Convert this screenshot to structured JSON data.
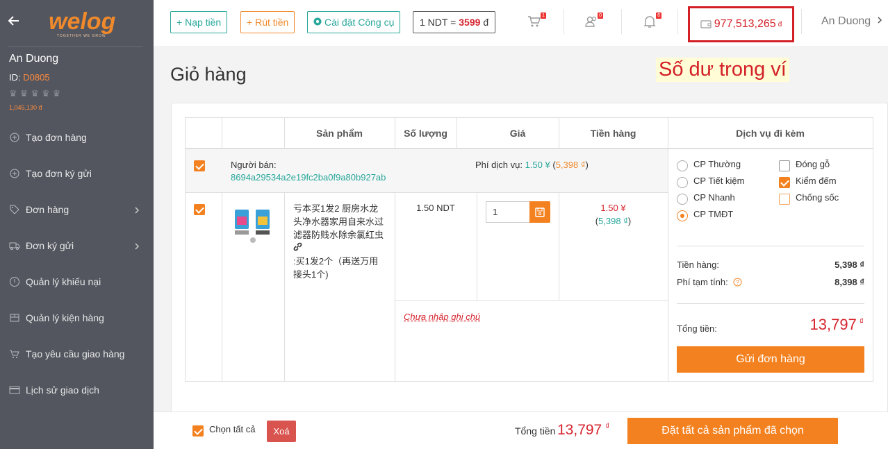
{
  "sidebar": {
    "user_name": "An Duong",
    "id_label": "ID:",
    "id_value": "D0805",
    "balance": "1,045,130 đ",
    "rating_stars": 5,
    "items": [
      {
        "label": "Tạo đơn hàng",
        "icon": "plus-circle-icon"
      },
      {
        "label": "Tạo đơn ký gửi",
        "icon": "plus-circle-icon"
      },
      {
        "label": "Đơn hàng",
        "icon": "tag-icon",
        "has_submenu": true
      },
      {
        "label": "Đơn ký gửi",
        "icon": "truck-icon",
        "has_submenu": true
      },
      {
        "label": "Quản lý khiếu nại",
        "icon": "alert-circle-icon"
      },
      {
        "label": "Quản lý kiện hàng",
        "icon": "package-icon"
      },
      {
        "label": "Tạo yêu cầu giao hàng",
        "icon": "cart-icon"
      },
      {
        "label": "Lịch sử giao dịch",
        "icon": "credit-card-icon"
      }
    ]
  },
  "header": {
    "nap_tien": "Nạp tiền",
    "rut_tien": "Rút tiền",
    "cai_dat": "Cài đặt Công cụ",
    "rate_prefix": "1 NDT =",
    "rate_value": "3599",
    "rate_suffix": "đ",
    "cart_badge": "1",
    "users_badge": "0",
    "bell_badge": "6",
    "wallet_balance": "977,513,265",
    "wallet_currency": "đ",
    "user_name": "An Duong"
  },
  "page": {
    "title": "Giỏ hàng",
    "annotation": "Số dư trong ví"
  },
  "table": {
    "headers": [
      "Sản phẩm",
      "Số lượng",
      "Giá",
      "Tiền hàng",
      "Dịch vụ đi kèm"
    ],
    "seller_label": "Người bán:",
    "seller_id": "8694a29534a2e19fc2ba0f9a80b927ab",
    "service_fee_label": "Phí dịch vụ:",
    "service_fee_cny": "1.50 ¥",
    "service_fee_vnd": "5,398 ₫",
    "product": {
      "name_lines": [
        "亏本买1发2 厨房水龙",
        "头净水器家用自来水过",
        "滤器防贱水除余氯红虫"
      ],
      "variant_lines": [
        ":买1发2个（再送万用",
        "接头1个)"
      ],
      "qty_price": "1.50 NDT",
      "quantity": "1",
      "price_cny": "1.50 ¥",
      "price_vnd": "5,398 ₫",
      "note_placeholder": "Chưa nhập ghi chú"
    },
    "shipping_options": [
      {
        "label": "CP Thường",
        "selected": false
      },
      {
        "label": "CP Tiết kiệm",
        "selected": false
      },
      {
        "label": "CP Nhanh",
        "selected": false
      },
      {
        "label": "CP TMĐT",
        "selected": true
      }
    ],
    "extra_services": [
      {
        "label": "Đóng gỗ",
        "checked": false
      },
      {
        "label": "Kiểm đếm",
        "checked": true
      },
      {
        "label": "Chống sốc",
        "checked": false
      }
    ],
    "summary": {
      "tien_hang_label": "Tiền hàng:",
      "tien_hang_value": "5,398 ₫",
      "phi_tam_tinh_label": "Phí tạm tính:",
      "phi_tam_tinh_value": "8,398 ₫",
      "tong_tien_label": "Tổng tiền:",
      "tong_tien_value": "13,797",
      "currency": "₫",
      "send_button": "Gửi đơn hàng"
    }
  },
  "footer": {
    "select_all": "Chọn tất cả",
    "delete": "Xoá",
    "total_label": "Tổng tiền",
    "total_value": "13,797",
    "currency": "₫",
    "order_all": "Đặt tất cả sản phẩm đã chọn"
  },
  "colors": {
    "sidebar_bg": "#53565f",
    "accent_orange": "#f4811f",
    "accent_green": "#27a79a",
    "accent_red": "#d32027"
  }
}
